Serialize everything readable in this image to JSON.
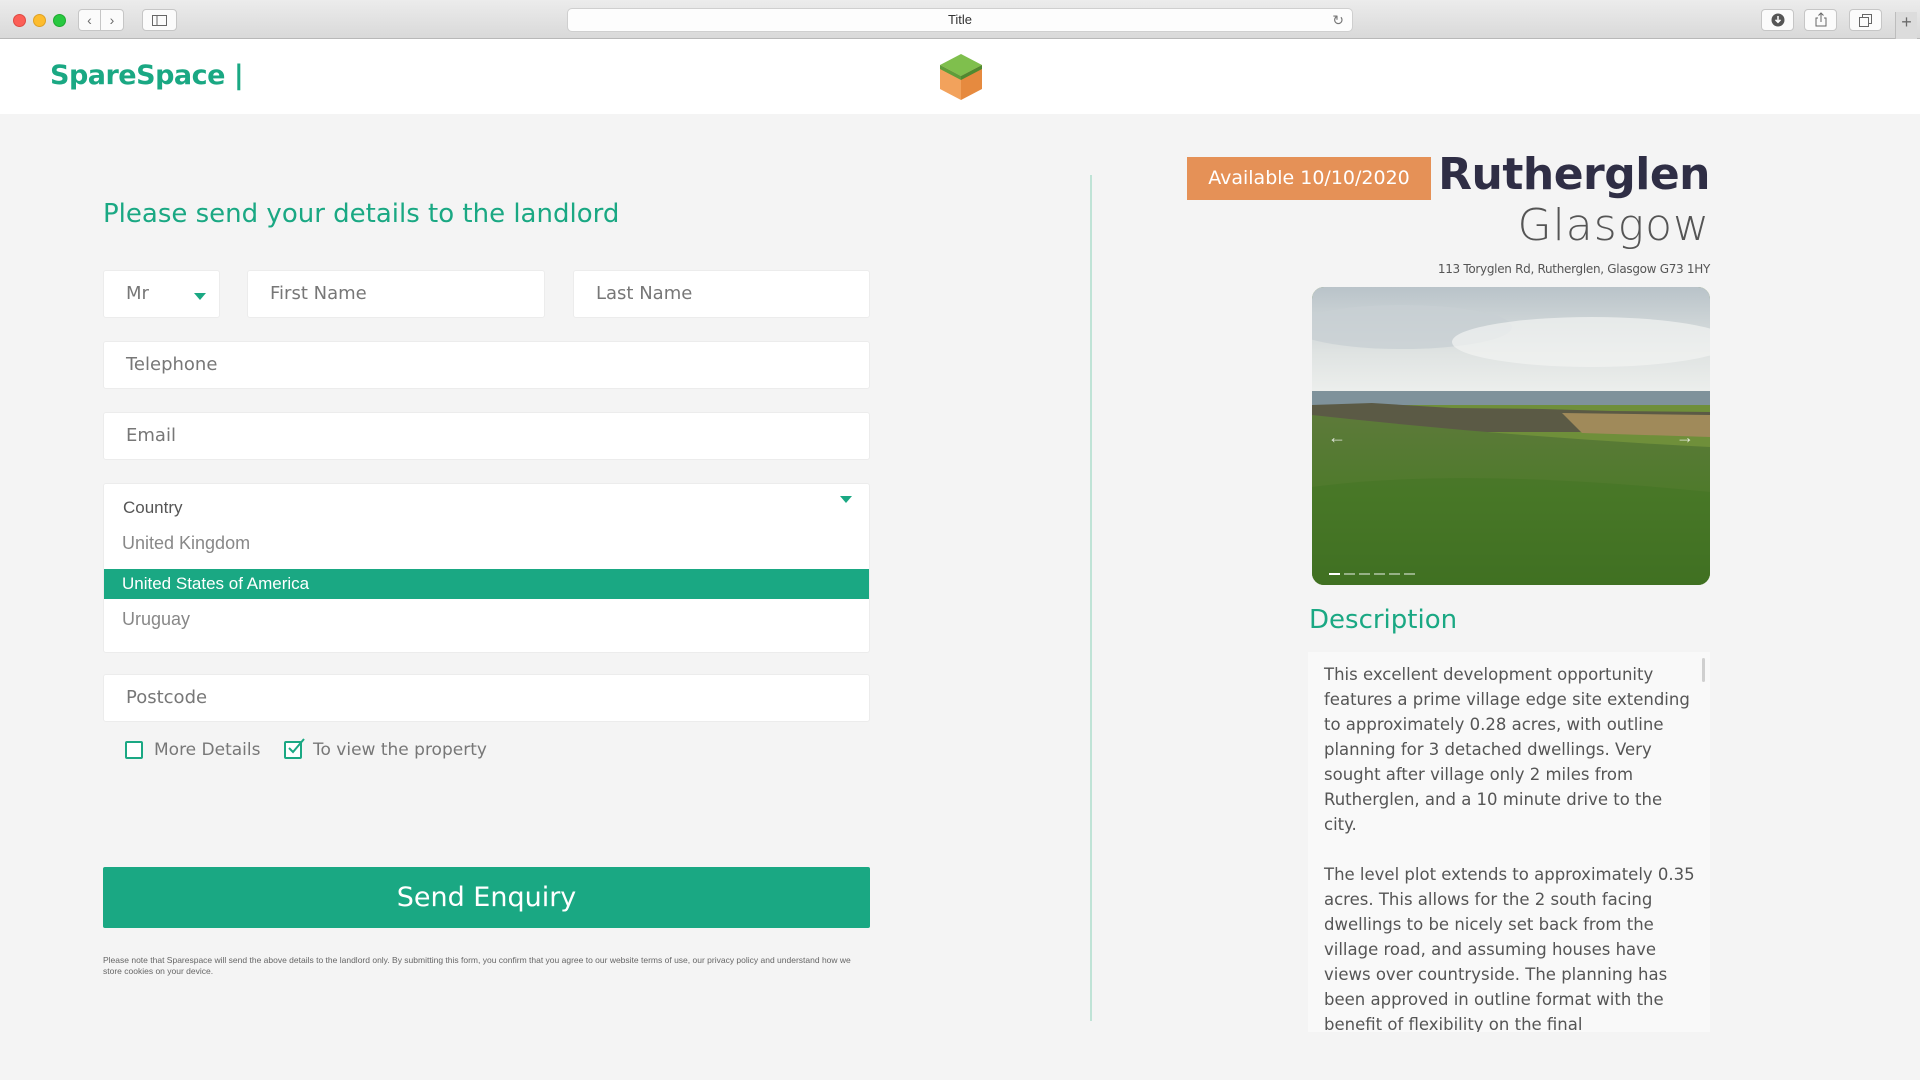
{
  "browser": {
    "title": "Title",
    "back_icon": "‹",
    "forward_icon": "›",
    "reload_icon": "↻",
    "new_tab_icon": "+"
  },
  "header": {
    "brand": "SpareSpace |",
    "logo_icon": "cube-logo-icon"
  },
  "form": {
    "heading": "Please send your details to the landlord",
    "title_value": "Mr",
    "first_name_placeholder": "First Name",
    "last_name_placeholder": "Last Name",
    "telephone_placeholder": "Telephone",
    "email_placeholder": "Email",
    "country": {
      "label": "Country",
      "options": [
        "United Kingdom",
        "United States of America",
        "Uruguay"
      ],
      "selected": "United States of America"
    },
    "postcode_placeholder": "Postcode",
    "checkboxes": [
      {
        "label": "More Details",
        "checked": false
      },
      {
        "label": "To view the property",
        "checked": true
      }
    ],
    "submit_label": "Send Enquiry",
    "disclaimer": "Please note that Sparespace will send the above details to the landlord only. By submitting this form, you confirm that you agree to our website terms of use, our privacy policy and understand how we store cookies on your device."
  },
  "property": {
    "availability": "Available 10/10/2020",
    "name": "Rutherglen",
    "city": "Glasgow",
    "address": "113 Toryglen Rd, Rutherglen, Glasgow G73 1HY",
    "gallery": {
      "prev_icon": "←",
      "next_icon": "→",
      "slide_count": 6,
      "active_slide": 1
    },
    "description_heading": "Description",
    "description": [
      "This excellent development opportunity features a prime village edge site extending to approximately 0.28 acres, with outline planning for 3 detached dwellings. Very sought after village only 2 miles from Rutherglen, and a 10 minute drive to the city.",
      "The level plot extends to approximately 0.35 acres. This allows for the 2 south facing dwellings to be nicely set back from the village road, and assuming houses have views over countryside. The planning has been approved in outline format with the benefit of flexibility on the final layout/design. Full details are available from District Council ( Tel:"
    ]
  },
  "colors": {
    "accent": "#1aa883",
    "badge": "#e59157",
    "title": "#2f2e45",
    "background": "#f4f4f4"
  }
}
